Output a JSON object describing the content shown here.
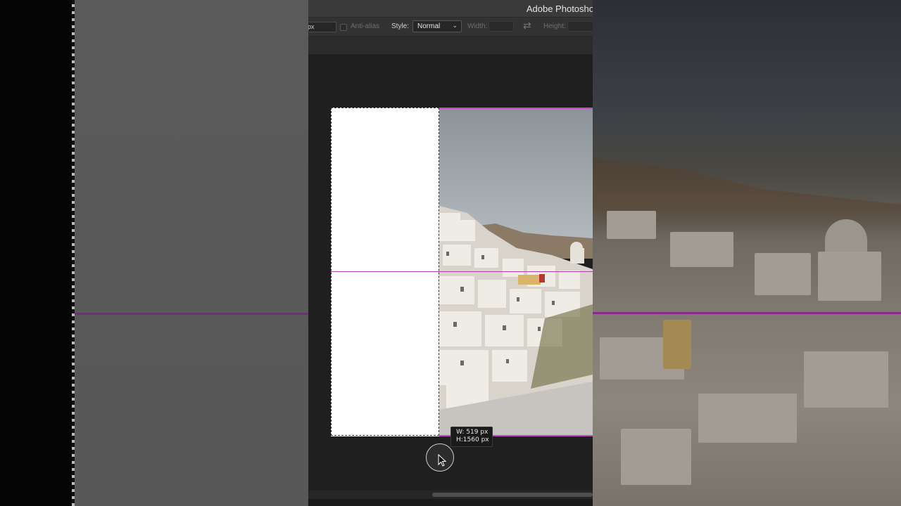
{
  "app": {
    "title": "Adobe Photosho"
  },
  "options_bar": {
    "feather_value": "px",
    "anti_alias_label": "Anti-alias",
    "style_label": "Style:",
    "style_value": "Normal",
    "width_label": "Width:",
    "height_label": "Height:"
  },
  "selection_info": {
    "width": "W:   519 px",
    "height": "H:1560 px"
  },
  "icons": [
    "chevron-down-icon",
    "swap-icon",
    "cursor-arrow-icon"
  ],
  "colors": {
    "guide": "#c24ac2",
    "canvas_bg": "#1f1f1f",
    "panel_bg": "#323232"
  }
}
